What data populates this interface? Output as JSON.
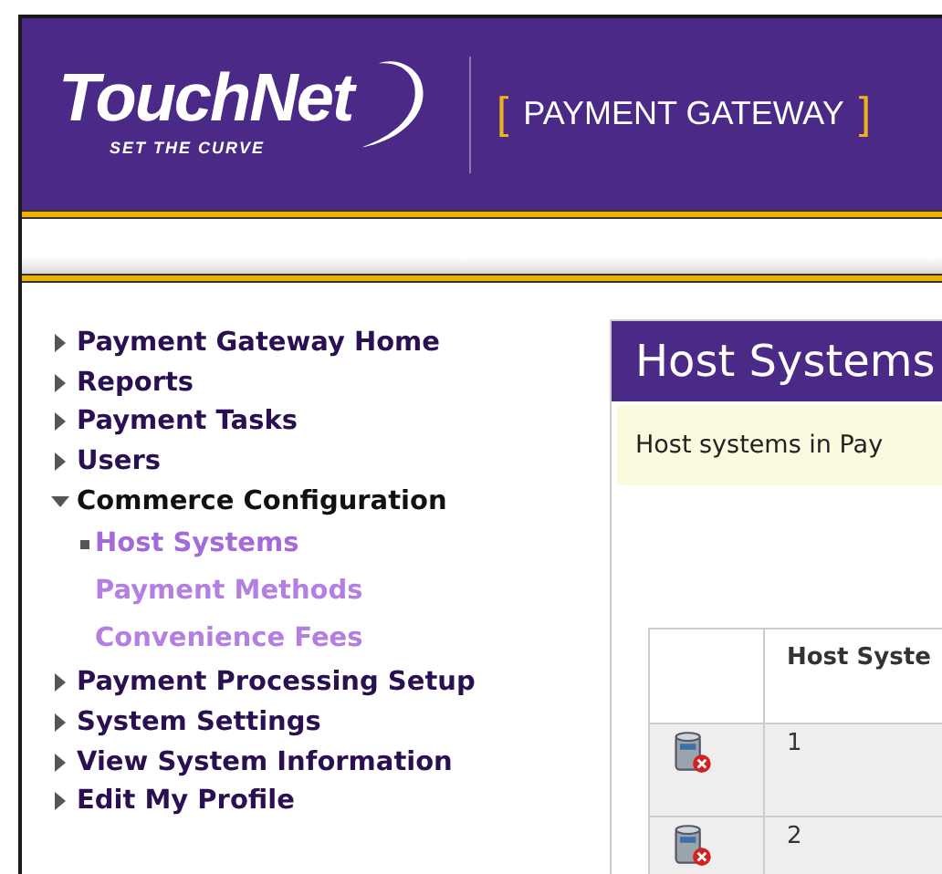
{
  "header": {
    "logo": "TouchNet",
    "tagline": "SET THE CURVE",
    "product": "PAYMENT GATEWAY",
    "brackets": [
      "[",
      "]"
    ]
  },
  "sidebar": {
    "items": [
      {
        "label": "Payment Gateway Home",
        "expanded": false
      },
      {
        "label": "Reports",
        "expanded": false
      },
      {
        "label": "Payment Tasks",
        "expanded": false
      },
      {
        "label": "Users",
        "expanded": false
      },
      {
        "label": "Commerce Configuration",
        "expanded": true,
        "children": [
          {
            "label": "Host Systems",
            "selected": true
          },
          {
            "label": "Payment Methods",
            "selected": false
          },
          {
            "label": "Convenience Fees",
            "selected": false
          }
        ]
      },
      {
        "label": "Payment Processing Setup",
        "expanded": false
      },
      {
        "label": "System Settings",
        "expanded": false
      },
      {
        "label": "View System Information",
        "expanded": false
      },
      {
        "label": "Edit My Profile",
        "expanded": false
      }
    ]
  },
  "main": {
    "title": "Host Systems",
    "note": "Host systems in Pay",
    "table": {
      "columns": [
        {
          "label": "Host Syste"
        }
      ],
      "rows": [
        {
          "cells": [
            "1"
          ]
        },
        {
          "cells": [
            "2"
          ]
        }
      ]
    }
  }
}
